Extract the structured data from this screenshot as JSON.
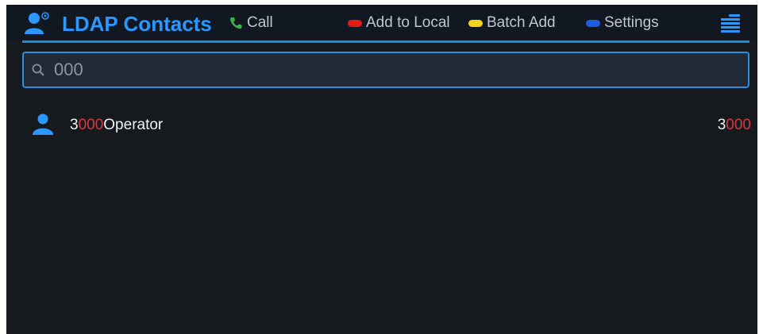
{
  "header": {
    "title": "LDAP Contacts",
    "softkeys": {
      "call": {
        "label": "Call",
        "color": "#39b54a"
      },
      "add_local": {
        "label": "Add to Local",
        "color": "#e21b1b"
      },
      "batch_add": {
        "label": "Batch Add",
        "color": "#f2d21b"
      },
      "settings": {
        "label": "Settings",
        "color": "#1f5de0"
      }
    },
    "accent_color": "#2a98ff"
  },
  "search": {
    "value": "000",
    "icon": "search-icon"
  },
  "results": [
    {
      "name_prefix": "3",
      "name_match": "000",
      "name_suffix": "Operator",
      "number_prefix": "3",
      "number_match": "000",
      "icon": "contact-icon"
    }
  ],
  "highlight_color": "#d83a3a"
}
